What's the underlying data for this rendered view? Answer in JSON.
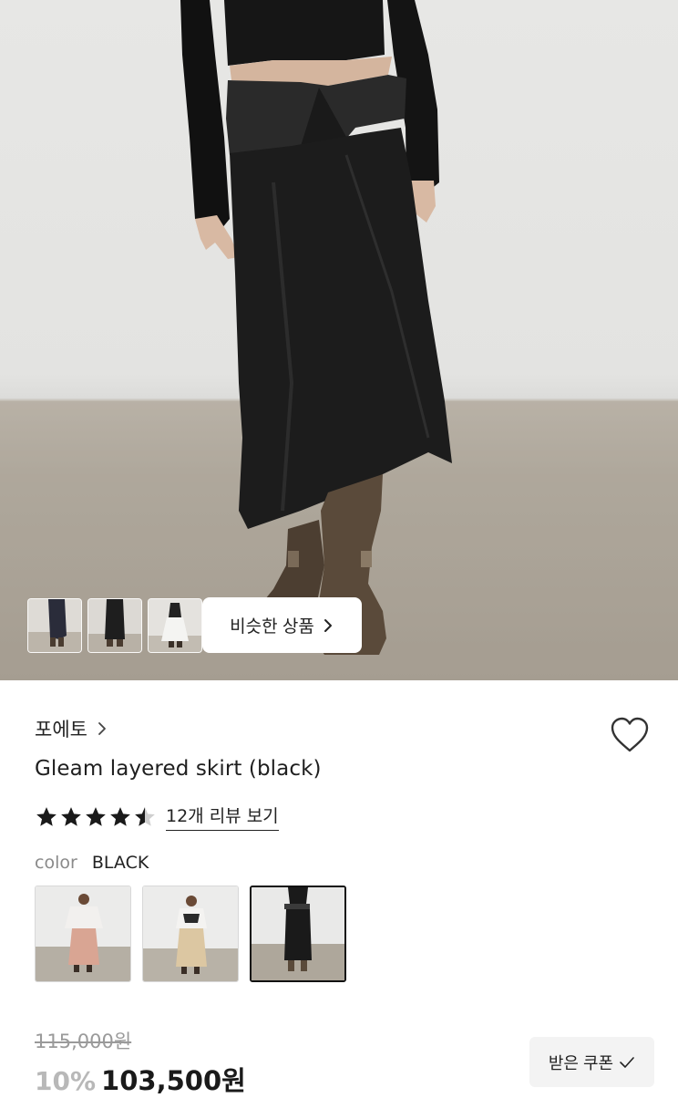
{
  "gallery": {
    "similar_label": "비슷한 상품",
    "thumbnails": [
      "thumbnail-1",
      "thumbnail-2",
      "thumbnail-3"
    ]
  },
  "product": {
    "brand": "포에토",
    "title": "Gleam layered skirt (black)",
    "rating": 4.5,
    "review_link": "12개 리뷰 보기",
    "color_label": "color",
    "color_value": "BLACK",
    "swatches": [
      {
        "name": "pink",
        "selected": false
      },
      {
        "name": "beige",
        "selected": false
      },
      {
        "name": "black",
        "selected": true
      }
    ],
    "original_price": "115,000원",
    "discount": "10%",
    "price": "103,500원"
  },
  "coupon": {
    "label": "받은 쿠폰"
  },
  "icons": {
    "brand_chevron": "chevron-right-icon",
    "similar_chevron": "chevron-right-icon",
    "wishlist": "heart-icon",
    "coupon_check": "check-icon"
  },
  "colors": {
    "star": "#1a1a1a",
    "discount": "#b8b8b8",
    "coupon_bg": "#f3f3f3"
  }
}
